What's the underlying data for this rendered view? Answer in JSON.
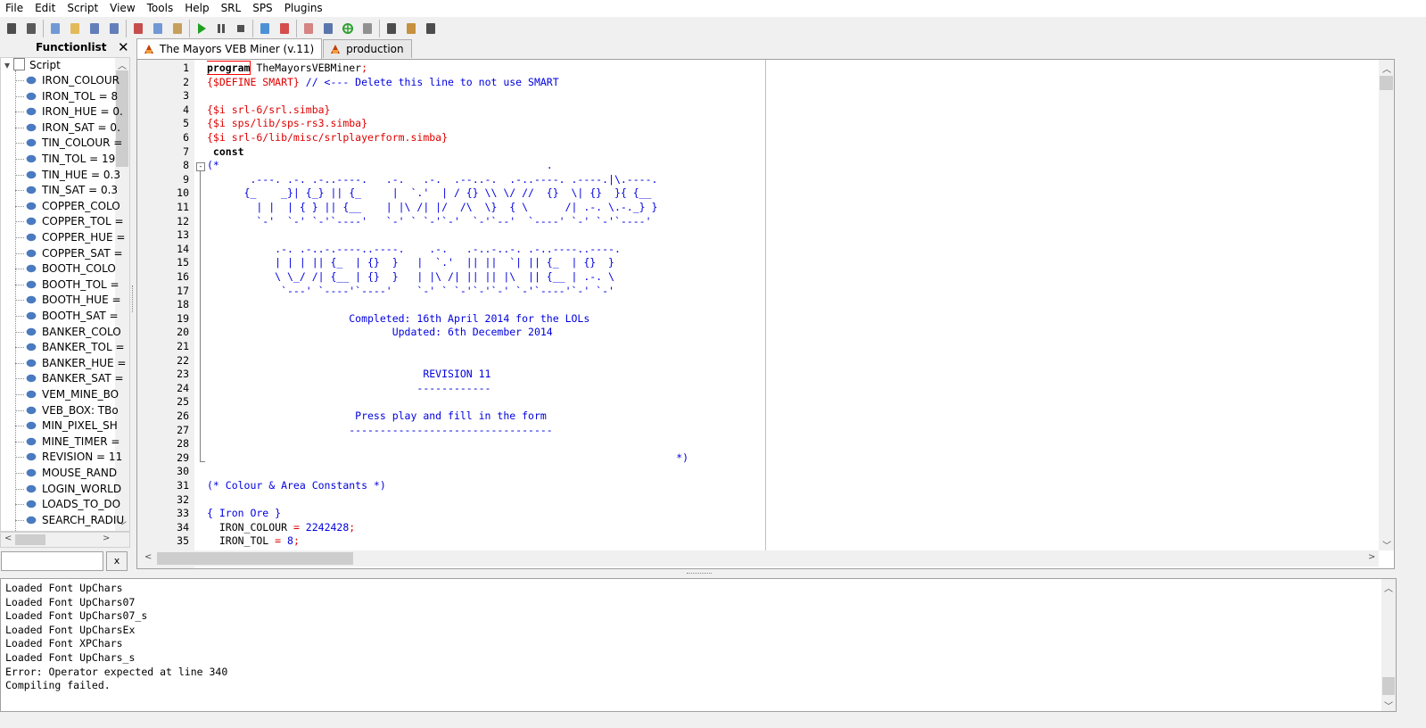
{
  "menu": [
    "File",
    "Edit",
    "Script",
    "View",
    "Tools",
    "Help",
    "SRL",
    "SPS",
    "Plugins"
  ],
  "toolbar_icons": [
    "paw-icon",
    "bug-icon",
    "new-file-icon",
    "open-folder-icon",
    "save-icon",
    "save-all-icon",
    "cut-icon",
    "copy-icon",
    "paste-icon",
    "run-icon",
    "pause-icon",
    "stop-icon",
    "add-target-icon",
    "remove-target-icon",
    "eraser-icon",
    "color-picker-icon",
    "target-crosshair-icon",
    "select-window-icon",
    "puzzle-icon",
    "hook-icon",
    "console-icon"
  ],
  "functionlist": {
    "title": "Functionlist",
    "close": "✕",
    "root": "Script",
    "items": [
      "IRON_COLOUR",
      "IRON_TOL = 8",
      "IRON_HUE = 0.",
      "IRON_SAT = 0.",
      "TIN_COLOUR =",
      "TIN_TOL = 19",
      "TIN_HUE = 0.3",
      "TIN_SAT = 0.3",
      "COPPER_COLO",
      "COPPER_TOL =",
      "COPPER_HUE =",
      "COPPER_SAT =",
      "BOOTH_COLO",
      "BOOTH_TOL =",
      "BOOTH_HUE =",
      "BOOTH_SAT =",
      "BANKER_COLO",
      "BANKER_TOL =",
      "BANKER_HUE =",
      "BANKER_SAT =",
      "VEM_MINE_BO",
      "VEB_BOX: TBo",
      "MIN_PIXEL_SH",
      "MINE_TIMER =",
      "REVISION = 11",
      "MOUSE_RAND",
      "LOGIN_WORLD",
      "LOADS_TO_DO",
      "SEARCH_RADIU"
    ],
    "search_value": "",
    "clear_label": "x"
  },
  "tabs": [
    {
      "label": "The Mayors VEB Miner (v.11)",
      "active": true
    },
    {
      "label": "production",
      "active": false
    }
  ],
  "editor": {
    "line_numbers": [
      "1",
      "2",
      "3",
      "4",
      "5",
      "6",
      "7",
      "8",
      "9",
      "10",
      "11",
      "12",
      "13",
      "14",
      "15",
      "16",
      "17",
      "18",
      "19",
      "20",
      "21",
      "22",
      "23",
      "24",
      "25",
      "26",
      "27",
      "28",
      "29",
      "30",
      "31",
      "32",
      "33",
      "34",
      "35"
    ],
    "lines": [
      [
        {
          "t": "program",
          "c": "#000",
          "b": true
        },
        {
          "t": " TheMayorsVEBMiner",
          "c": "#000"
        },
        {
          "t": ";",
          "c": "#e00000"
        }
      ],
      [
        {
          "t": "{$DEFINE SMART}",
          "c": "#e00000"
        },
        {
          "t": " // <--- Delete this line to not use SMART",
          "c": "#0000e0"
        }
      ],
      [],
      [
        {
          "t": "{$i srl-6/srl.simba}",
          "c": "#e00000"
        }
      ],
      [
        {
          "t": "{$i sps/lib/sps-rs3.simba}",
          "c": "#e00000"
        }
      ],
      [
        {
          "t": "{$i srl-6/lib/misc/srlplayerform.simba}",
          "c": "#e00000"
        }
      ],
      [
        {
          "t": " const",
          "c": "#000",
          "b": true
        }
      ],
      [
        {
          "t": "(*                                                     .",
          "c": "#0000e0"
        }
      ],
      [
        {
          "t": "       .---. .-. .-..----.   .-.   .-.  .--..-.  .-..----. .----.|\\.----.",
          "c": "#0000e0"
        }
      ],
      [
        {
          "t": "      {_    _}| {_} || {_     |  `.'  | / {} \\\\ \\/ //  {}  \\| {}  }{ {__",
          "c": "#0000e0"
        }
      ],
      [
        {
          "t": "        | |  | { } || {__    | |\\ /| |/  /\\  \\}  { \\      /| .-. \\.-._} }",
          "c": "#0000e0"
        }
      ],
      [
        {
          "t": "        `-'  `-' `-'`----'   `-' ` `-'`-'  `-'`--'  `----' `-' `-'`----'",
          "c": "#0000e0"
        }
      ],
      [],
      [
        {
          "t": "           .-. .-..-.----..----.    .-.   .-..-..-. .-..----..----.",
          "c": "#0000e0"
        }
      ],
      [
        {
          "t": "           | | | || {_  | {}  }   |  `.'  || ||  `| || {_  | {}  }",
          "c": "#0000e0"
        }
      ],
      [
        {
          "t": "           \\ \\_/ /| {__ | {}  }   | |\\ /| || || |\\  || {__ | .-. \\",
          "c": "#0000e0"
        }
      ],
      [
        {
          "t": "            `---' `----'`----'    `-' ` `-'`-'`-' `-'`----'`-' `-'",
          "c": "#0000e0"
        }
      ],
      [],
      [
        {
          "t": "                       Completed: 16th April 2014 for the LOLs",
          "c": "#0000e0"
        }
      ],
      [
        {
          "t": "                              Updated: 6th December 2014",
          "c": "#0000e0"
        }
      ],
      [],
      [],
      [
        {
          "t": "                                   REVISION 11",
          "c": "#0000e0"
        }
      ],
      [
        {
          "t": "                                  ------------",
          "c": "#0000e0"
        }
      ],
      [],
      [
        {
          "t": "                        Press play and fill in the form",
          "c": "#0000e0"
        }
      ],
      [
        {
          "t": "                       ---------------------------------",
          "c": "#0000e0"
        }
      ],
      [],
      [
        {
          "t": "                                                                            *)",
          "c": "#0000e0"
        }
      ],
      [],
      [
        {
          "t": "(* Colour & Area Constants *)",
          "c": "#0000e0"
        }
      ],
      [],
      [
        {
          "t": "{ Iron Ore }",
          "c": "#0000e0"
        }
      ],
      [
        {
          "t": "  IRON_COLOUR ",
          "c": "#000"
        },
        {
          "t": "=",
          "c": "#e00000"
        },
        {
          "t": " 2242428",
          "c": "#0000e0"
        },
        {
          "t": ";",
          "c": "#e00000"
        }
      ],
      [
        {
          "t": "  IRON_TOL ",
          "c": "#000"
        },
        {
          "t": "=",
          "c": "#e00000"
        },
        {
          "t": " 8",
          "c": "#0000e0"
        },
        {
          "t": ";",
          "c": "#e00000"
        }
      ]
    ]
  },
  "console": {
    "lines": [
      "Loaded Font UpChars",
      "Loaded Font UpChars07",
      "Loaded Font UpChars07_s",
      "Loaded Font UpCharsEx",
      "Loaded Font XPChars",
      "Loaded Font UpChars_s",
      "Error: Operator expected at line 340",
      "Compiling failed."
    ]
  },
  "colors": {
    "keyword": "#000000",
    "directive": "#e00000",
    "comment": "#0000e0",
    "highlight_box": "#ff0000"
  }
}
